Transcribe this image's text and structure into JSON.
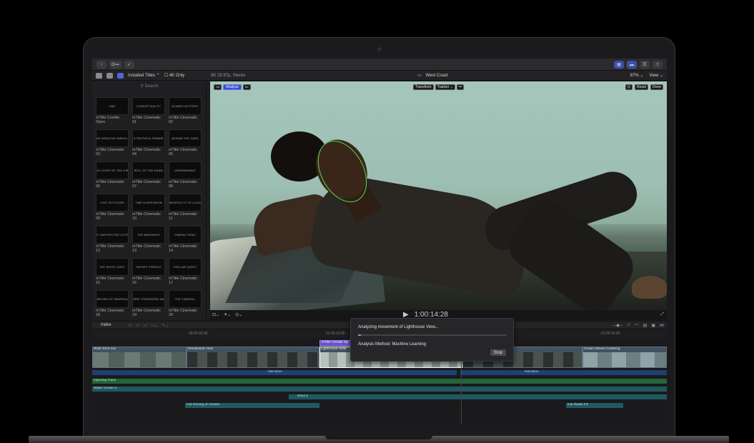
{
  "toolbar": {
    "import_label": "↓",
    "keyword_label": "O⊶",
    "check_label": "✓",
    "share_label": "⇪"
  },
  "libbar": {
    "installed_titles": "Installed Titles ⌃",
    "four_k_only": "4K Only",
    "format_info": "8K 29.97p, Stereo",
    "project_name": "West Coast",
    "zoom": "67% ⌄",
    "view": "View ⌄"
  },
  "browser": {
    "search_placeholder": "Search",
    "titles": [
      {
        "thumb": "ONE",
        "caption": "mTitle Credits Open"
      },
      {
        "thumb": "CONCEPTUALITY",
        "caption": "mTitle Cinematic 01"
      },
      {
        "thumb": "SCARED MYSTERY",
        "caption": "mTitle Cinematic 02"
      },
      {
        "thumb": "THE NEGATIVE MIRACLE",
        "caption": "mTitle Cinematic 03"
      },
      {
        "thumb": "A TRUTHFUL REMINE",
        "caption": "mTitle Cinematic 04"
      },
      {
        "thumb": "BEHIND THE CARD",
        "caption": "mTitle Cinematic 05"
      },
      {
        "thumb": "THE LOVER OF THE GIRL",
        "caption": "mTitle Cinematic 06"
      },
      {
        "thumb": "ROLL OF THE DOWN",
        "caption": "mTitle Cinematic 07"
      },
      {
        "thumb": "UNVENERABLE",
        "caption": "mTitle Cinematic 08"
      },
      {
        "thumb": "Lost in future",
        "caption": "mTitle Cinematic 09"
      },
      {
        "thumb": "TIME SUSPENSION",
        "caption": "mTitle Cinematic 10"
      },
      {
        "thumb": "IMMORTALITY OF A SOUL",
        "caption": "mTitle Cinematic 11"
      },
      {
        "thumb": "THE UNEXPECTED LETTER",
        "caption": "mTitle Cinematic 12"
      },
      {
        "thumb": "THE BARKNESS",
        "caption": "mTitle Cinematic 13"
      },
      {
        "thumb": "CINEMA TODAY",
        "caption": "mTitle Cinematic 14"
      },
      {
        "thumb": "THE WHITE LIGHT",
        "caption": "mTitle Cinematic 15"
      },
      {
        "thumb": "FARGRY PURSUIT",
        "caption": "mTitle Cinematic 16"
      },
      {
        "thumb": "STELLAR QUEST",
        "caption": "mTitle Cinematic 17"
      },
      {
        "thumb": "WARRIORS OF WAKERLAND",
        "caption": "mTitle Cinematic 18"
      },
      {
        "thumb": "WHERE STRANGERS MEET",
        "caption": "mTitle Cinematic 19"
      },
      {
        "thumb": "THE FUNERAL",
        "caption": "mTitle Cinematic 20"
      }
    ]
  },
  "viewer": {
    "analyze_label": "Analyze",
    "transform_label": "Transform",
    "tracker_label": "Tracker ⌄",
    "reset_label": "Reset",
    "done_label": "Done",
    "timecode": "1:00:14:28"
  },
  "timeline": {
    "index_label": "Index",
    "ruler": [
      "00:00:05:00",
      "01:00:10:00",
      "01:00:20:00"
    ],
    "title_clip": "mTitle Credits Op",
    "clips": [
      "Wide Shot Car",
      "Windshield View",
      "Lighthouse View",
      "Ocean Waves Crashing"
    ],
    "narration": [
      "Narration",
      "Narration"
    ],
    "lanes": {
      "opening_track": "Opening Track",
      "water_ocean": "Water Ocean 3",
      "wind": "Wind 2",
      "car_driving": "Car Driving on Gravel",
      "car_radio": "Car Radio FX"
    }
  },
  "popover": {
    "title": "Analyzing movement of Lighthouse View...",
    "method": "Analysis Method: Machine Learning",
    "stop_label": "Stop",
    "progress": 0.02
  },
  "colors": {
    "accent": "#3d4bd0",
    "title_purple": "#6a4bd1",
    "tracker_green": "#4fdc5a",
    "narration_blue": "#1f3f74",
    "music_green": "#23643a",
    "sfx_teal": "#1f5a60"
  }
}
